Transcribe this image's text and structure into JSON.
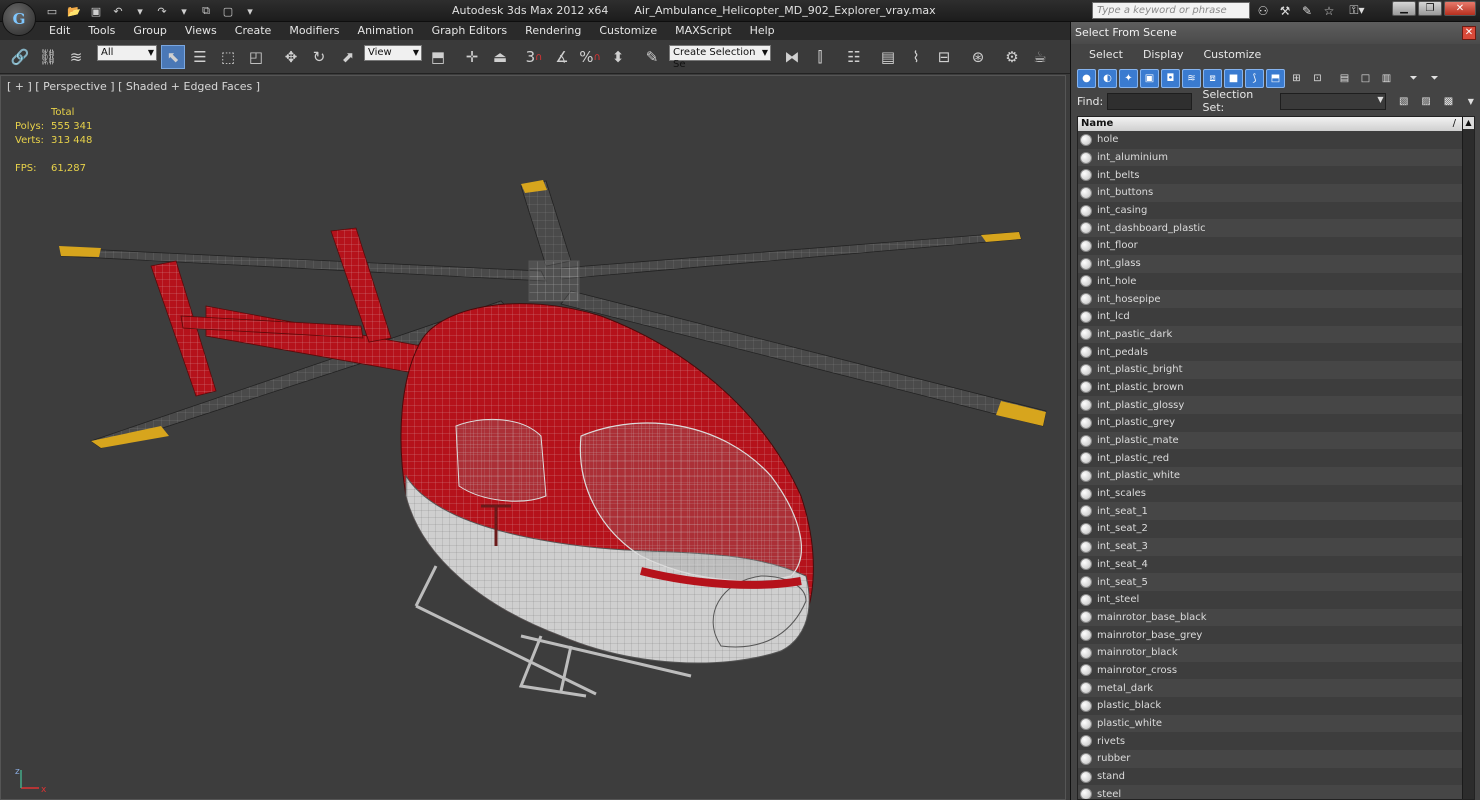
{
  "window": {
    "app_title": "Autodesk 3ds Max  2012 x64",
    "file_title": "Air_Ambulance_Helicopter_MD_902_Explorer_vray.max",
    "logo_glyph": "G"
  },
  "help_search": {
    "placeholder": "Type a keyword or phrase"
  },
  "menubar": {
    "items": [
      "Edit",
      "Tools",
      "Group",
      "Views",
      "Create",
      "Modifiers",
      "Animation",
      "Graph Editors",
      "Rendering",
      "Customize",
      "MAXScript",
      "Help"
    ]
  },
  "toolbar": {
    "selection_filter": "All",
    "ref_coord": "View",
    "named_selection": "Create Selection Se",
    "snap_3": "3",
    "percent_snap": "%"
  },
  "viewport": {
    "label": "[ + ] [ Perspective ] [ Shaded + Edged Faces ]",
    "stats_header": "Total",
    "polys_label": "Polys:",
    "polys_value": "555 341",
    "verts_label": "Verts:",
    "verts_value": "313 448",
    "fps_label": "FPS:",
    "fps_value": "61,287",
    "axis_x": "x",
    "axis_z": "z"
  },
  "scene_panel": {
    "title": "Select From Scene",
    "menu": [
      "Select",
      "Display",
      "Customize"
    ],
    "find_label": "Find:",
    "selection_set_label": "Selection Set:",
    "column_name": "Name",
    "sort_glyph": "/",
    "items": [
      "hole",
      "int_aluminium",
      "int_belts",
      "int_buttons",
      "int_casing",
      "int_dashboard_plastic",
      "int_floor",
      "int_glass",
      "int_hole",
      "int_hosepipe",
      "int_lcd",
      "int_pastic_dark",
      "int_pedals",
      "int_plastic_bright",
      "int_plastic_brown",
      "int_plastic_glossy",
      "int_plastic_grey",
      "int_plastic_mate",
      "int_plastic_red",
      "int_plastic_white",
      "int_scales",
      "int_seat_1",
      "int_seat_2",
      "int_seat_3",
      "int_seat_4",
      "int_seat_5",
      "int_steel",
      "mainrotor_base_black",
      "mainrotor_base_grey",
      "mainrotor_black",
      "mainrotor_cross",
      "metal_dark",
      "plastic_black",
      "plastic_white",
      "rivets",
      "rubber",
      "stand",
      "steel"
    ]
  },
  "colors": {
    "accent_blue": "#3a7bd0",
    "stats_yellow": "#e8d24a",
    "heli_red": "#b5121b",
    "heli_white": "#d9d9d9",
    "blade_tip": "#e0b21b"
  }
}
